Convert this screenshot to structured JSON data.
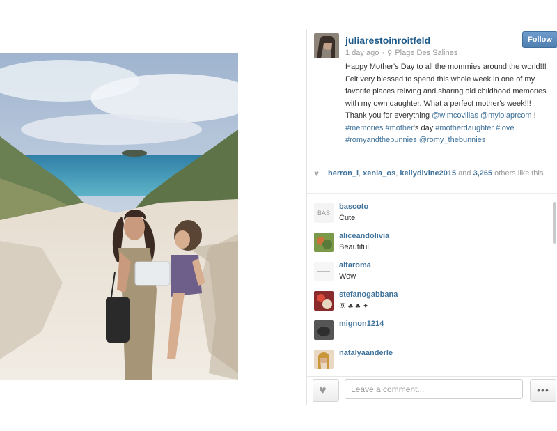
{
  "post": {
    "username": "juliarestoinroitfeld",
    "time": "1 day ago",
    "location_pin": "⚲",
    "location": "Plage Des Salines",
    "follow_label": "Follow",
    "caption_text": "Happy Mother's Day to all the mommies around the world!!! Felt very blessed to spend this whole week in one of my favorite places reliving and sharing old childhood memories with my own daughter. What a perfect mother's week!!! Thank you for everything",
    "mention_1": "@wimcovillas",
    "mention_2": "@mylolaprcom",
    "bang": "!",
    "tag_memories": "#memories",
    "tag_mother": "#mother",
    "caption_day": "'s day",
    "tag_motherdaughter": "#motherdaughter",
    "tag_love": "#love",
    "tag_romy": "#romyandthebunnies",
    "mention_3": "@romy_thebunnies"
  },
  "likes": {
    "heart": "♥",
    "user_1": "herron_l",
    "user_2": "xenia_os",
    "user_3": "kellydivine2015",
    "sep": ",",
    "and": "and",
    "count": "3,265",
    "suffix": "others like this."
  },
  "comments": [
    {
      "user": "bascoto",
      "text": "Cute",
      "avatar_text": "BAS",
      "avatar_color": "#f4f4f4"
    },
    {
      "user": "aliceandolivia",
      "text": "Beautiful",
      "avatar_color": "#7a9a4a"
    },
    {
      "user": "altaroma",
      "text": "Wow",
      "avatar_color": "#f6f6f6"
    },
    {
      "user": "stefanogabbana",
      "text": "⑨ ♣ ♣ ✦",
      "avatar_color": "#8a2a2a"
    },
    {
      "user": "mignon1214",
      "text": "",
      "avatar_color": "#555555"
    },
    {
      "user": "natalyaanderle",
      "text": "",
      "avatar_color": "#c9a37a"
    }
  ],
  "composer": {
    "heart": "♥",
    "placeholder": "Leave a comment...",
    "more": "•••"
  },
  "colors": {
    "link": "#3f729b",
    "username": "#1d5a89",
    "follow_bg": "#5a89b8"
  }
}
